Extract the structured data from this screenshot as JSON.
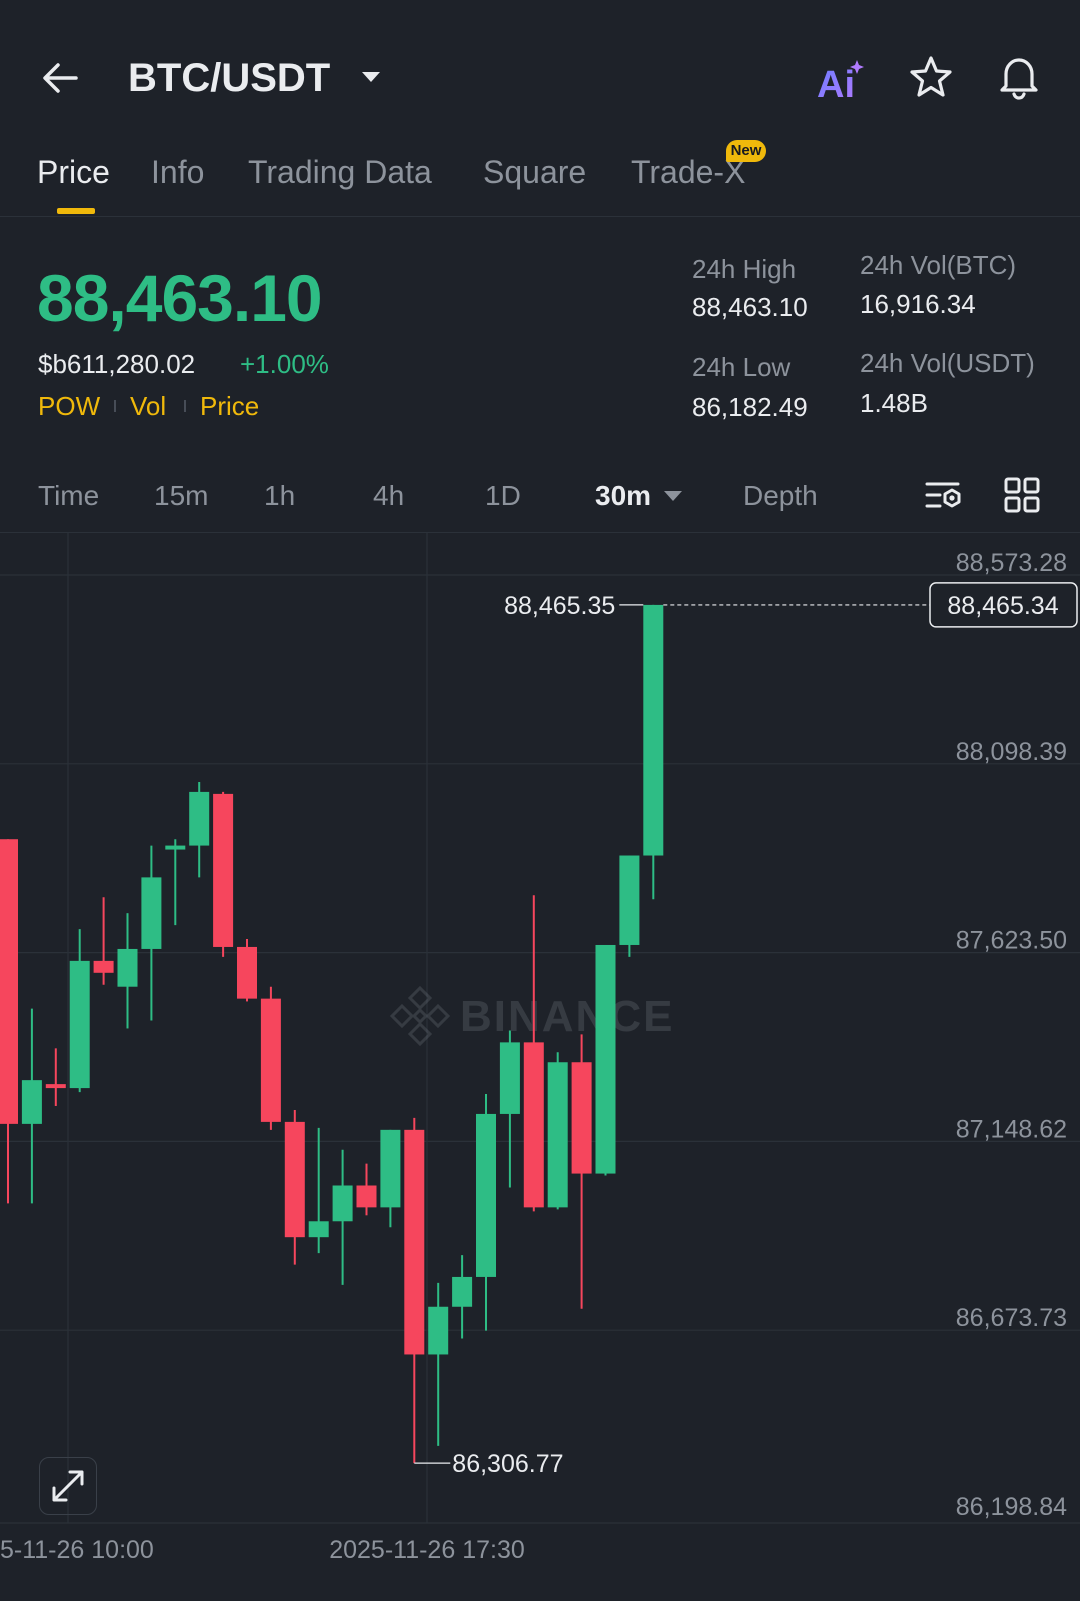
{
  "header": {
    "title": "BTC/USDT",
    "ai_label": "Ai"
  },
  "tabs": [
    {
      "label": "Price",
      "active": true
    },
    {
      "label": "Info"
    },
    {
      "label": "Trading Data"
    },
    {
      "label": "Square"
    },
    {
      "label": "Trade-X",
      "badge": "New"
    }
  ],
  "price": {
    "last": "88,463.10",
    "fiat": "$b611,280.02",
    "change": "+1.00%",
    "tags": [
      "POW",
      "Vol",
      "Price"
    ]
  },
  "stats": {
    "high_label": "24h High",
    "high": "88,463.10",
    "low_label": "24h Low",
    "low": "86,182.49",
    "vol_btc_label": "24h Vol(BTC)",
    "vol_btc": "16,916.34",
    "vol_usdt_label": "24h Vol(USDT)",
    "vol_usdt": "1.48B"
  },
  "intervals": [
    "Time",
    "15m",
    "1h",
    "4h",
    "1D",
    "30m",
    "Depth"
  ],
  "active_interval": "30m",
  "colors": {
    "up": "#2ebd85",
    "down": "#f6465d",
    "accent": "#f0b90b",
    "bg": "#1e2229"
  },
  "watermark": "BINANCE",
  "chart_data": {
    "type": "candlestick",
    "y_ticks": [
      "88,573.28",
      "88,098.39",
      "87,623.50",
      "87,148.62",
      "86,673.73",
      "86,198.84"
    ],
    "y_tick_values": [
      88573.28,
      88098.39,
      87623.5,
      87148.62,
      86673.73,
      86198.84
    ],
    "x_labels": [
      "5-11-26 10:00",
      "2025-11-26 17:30"
    ],
    "current_price_label": "88,465.34",
    "current_price": 88465.34,
    "high_marker_label": "88,465.35",
    "high_marker": 88465.35,
    "low_marker_label": "86,306.77",
    "low_marker": 86306.77,
    "candles": [
      {
        "o": 87876,
        "c": 87160,
        "h": 87876,
        "l": 86960
      },
      {
        "o": 87160,
        "c": 87270,
        "h": 87450,
        "l": 86960
      },
      {
        "o": 87260,
        "c": 87250,
        "h": 87350,
        "l": 87205
      },
      {
        "o": 87250,
        "c": 87570,
        "h": 87650,
        "l": 87240
      },
      {
        "o": 87570,
        "c": 87540,
        "h": 87730,
        "l": 87510
      },
      {
        "o": 87505,
        "c": 87600,
        "h": 87690,
        "l": 87400
      },
      {
        "o": 87600,
        "c": 87780,
        "h": 87860,
        "l": 87420
      },
      {
        "o": 87850,
        "c": 87860,
        "h": 87876,
        "l": 87660
      },
      {
        "o": 87860,
        "c": 87995,
        "h": 88020,
        "l": 87780
      },
      {
        "o": 87990,
        "c": 87605,
        "h": 87995,
        "l": 87580
      },
      {
        "o": 87605,
        "c": 87475,
        "h": 87625,
        "l": 87468
      },
      {
        "o": 87475,
        "c": 87165,
        "h": 87505,
        "l": 87145
      },
      {
        "o": 87165,
        "c": 86875,
        "h": 87195,
        "l": 86806
      },
      {
        "o": 86875,
        "c": 86915,
        "h": 87150,
        "l": 86835
      },
      {
        "o": 86915,
        "c": 87005,
        "h": 87095,
        "l": 86755
      },
      {
        "o": 87005,
        "c": 86950,
        "h": 87060,
        "l": 86930
      },
      {
        "o": 86950,
        "c": 87145,
        "h": 87145,
        "l": 86900
      },
      {
        "o": 87145,
        "c": 86580,
        "h": 87175,
        "l": 86306.77
      },
      {
        "o": 86580,
        "c": 86700,
        "h": 86760,
        "l": 86350
      },
      {
        "o": 86700,
        "c": 86775,
        "h": 86830,
        "l": 86620
      },
      {
        "o": 86775,
        "c": 87185,
        "h": 87235,
        "l": 86640
      },
      {
        "o": 87185,
        "c": 87365,
        "h": 87395,
        "l": 87000
      },
      {
        "o": 87365,
        "c": 86950,
        "h": 87735,
        "l": 86940
      },
      {
        "o": 86950,
        "c": 87315,
        "h": 87340,
        "l": 86945
      },
      {
        "o": 87315,
        "c": 87035,
        "h": 87385,
        "l": 86695
      },
      {
        "o": 87035,
        "c": 87610,
        "h": 87610,
        "l": 87030
      },
      {
        "o": 87610,
        "c": 87835,
        "h": 87835,
        "l": 87580
      },
      {
        "o": 87835,
        "c": 88465.35,
        "h": 88465.35,
        "l": 87725
      }
    ]
  }
}
